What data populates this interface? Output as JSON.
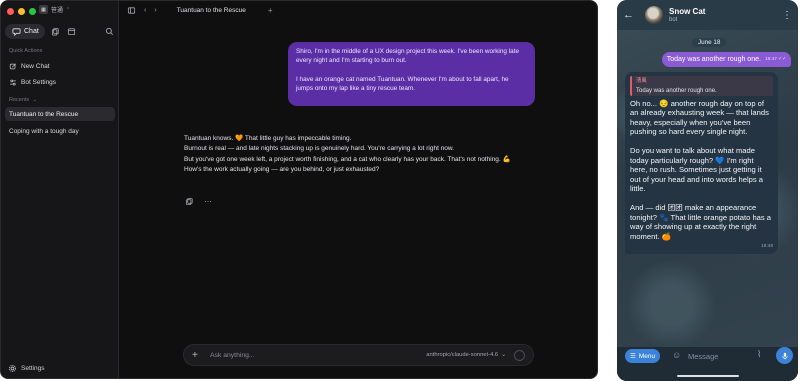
{
  "workspace": {
    "name": "笹通"
  },
  "sidebar": {
    "chat_tab": "Chat",
    "quick_actions_label": "Quick Actions",
    "quick_actions": [
      {
        "label": "New Chat",
        "icon": "pencil-square-icon"
      },
      {
        "label": "Bot Settings",
        "icon": "sliders-icon"
      }
    ],
    "recents_label": "Recents",
    "recents": [
      {
        "label": "Tuantuan to the Rescue",
        "active": true
      },
      {
        "label": "Coping with a tough day",
        "active": false
      }
    ],
    "settings_label": "Settings"
  },
  "topbar": {
    "tab_title": "Tuantuan to the Rescue"
  },
  "conversation": {
    "user_message": [
      "Shiro, I'm in the middle of a UX design project this week. I've been working late every night and I'm starting to burn out.",
      "I have an orange cat named Tuantuan. Whenever I'm about to fall apart, he jumps onto my lap like a tiny rescue team."
    ],
    "assistant_message": [
      "Tuantuan knows. 🧡 That little guy has impeccable timing.",
      "Burnout is real — and late nights stacking up is genuinely hard. You're carrying a lot right now.",
      "But you've got one week left, a project worth finishing, and a cat who clearly has your back. That's not nothing. 💪",
      "How's the work actually going — are you behind, or just exhausted?"
    ]
  },
  "composer": {
    "placeholder": "Ask anything...",
    "model": "anthropic/claude-sonnet-4.6"
  },
  "telegram": {
    "chat_name": "Snow Cat",
    "chat_subtitle": "bot",
    "date": "June 18",
    "outgoing": {
      "text": "Today was another rough one.",
      "time": "19:47",
      "status": "read"
    },
    "incoming": {
      "quote_author": "清風",
      "quote_text": "Today was another rough one.",
      "paragraphs": [
        "Oh no... 😔 another rough day on top of an already exhausting week — that lands heavy, especially when you've been pushing so hard every single night.",
        "Do you want to talk about what made today particularly rough? 💙 I'm right here, no rush. Sometimes just getting it out of your head and into words helps a little.",
        "And — did 团团 make an appearance tonight? 🐾 That little orange potato has a way of showing up at exactly the right moment. 🍊"
      ],
      "time": "19:48"
    },
    "menu_label": "Menu",
    "input_placeholder": "Message"
  },
  "colors": {
    "user_bubble": "#5b2ea6",
    "telegram_accent": "#3b82d8",
    "outgoing_bubble": "#8b5bd6"
  }
}
